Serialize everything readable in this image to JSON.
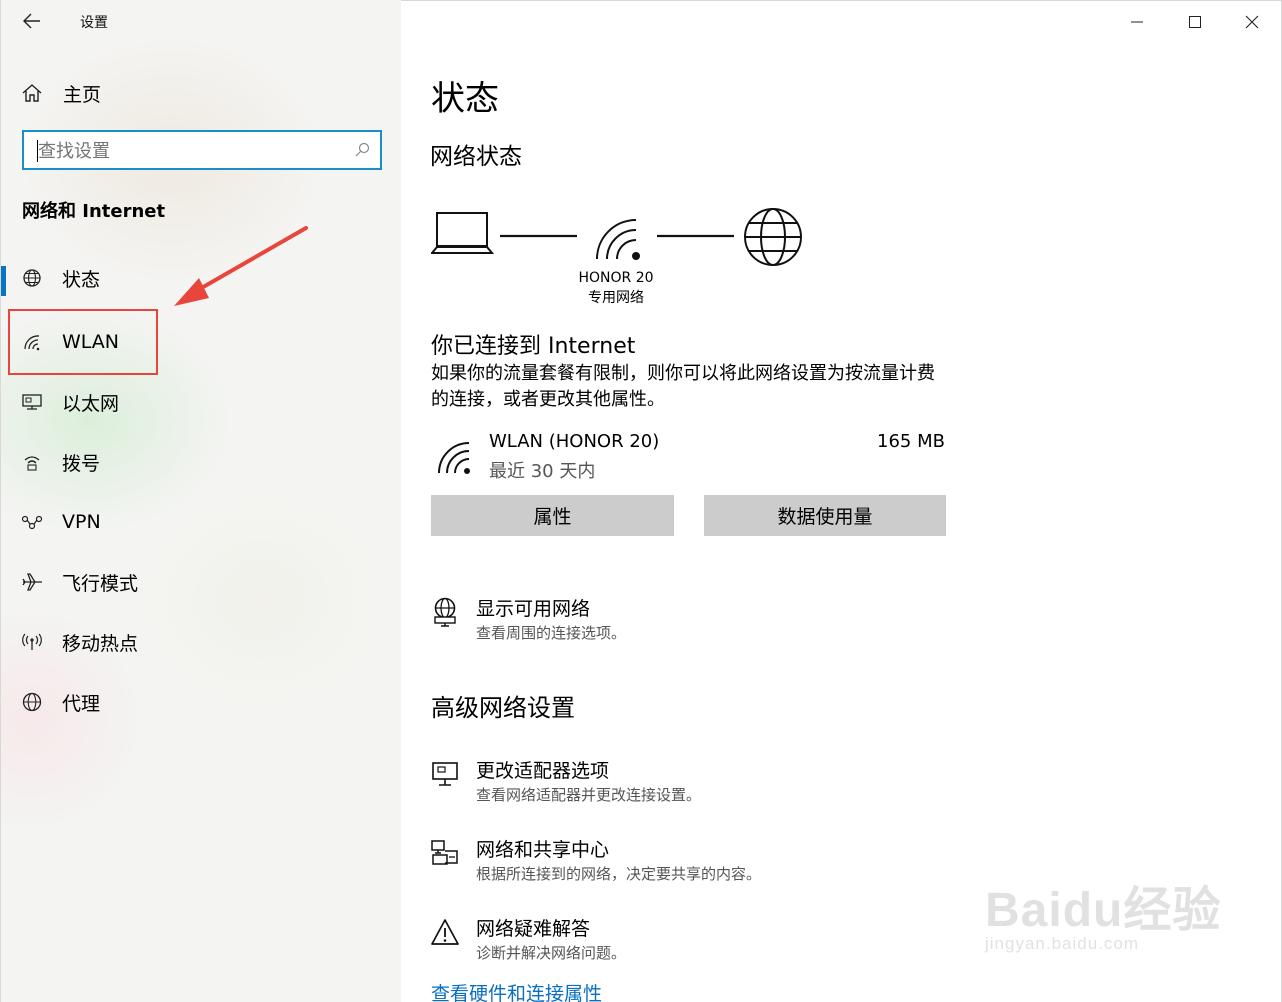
{
  "window": {
    "title": "设置",
    "controls": [
      "minimize",
      "maximize",
      "close"
    ]
  },
  "sidebar": {
    "home_label": "主页",
    "search_placeholder": "查找设置",
    "section_title": "网络和 Internet",
    "items": [
      {
        "label": "状态",
        "icon": "globe-status-icon",
        "active": true
      },
      {
        "label": "WLAN",
        "icon": "wifi-icon",
        "active": false
      },
      {
        "label": "以太网",
        "icon": "ethernet-icon",
        "active": false
      },
      {
        "label": "拨号",
        "icon": "dialup-icon",
        "active": false
      },
      {
        "label": "VPN",
        "icon": "vpn-icon",
        "active": false
      },
      {
        "label": "飞行模式",
        "icon": "airplane-icon",
        "active": false
      },
      {
        "label": "移动热点",
        "icon": "hotspot-icon",
        "active": false
      },
      {
        "label": "代理",
        "icon": "globe-icon",
        "active": false
      }
    ]
  },
  "main": {
    "page_title": "状态",
    "network_status_title": "网络状态",
    "network_name": "HONOR 20",
    "network_type": "专用网络",
    "connected_title": "你已连接到 Internet",
    "connected_desc": "如果你的流量套餐有限制，则你可以将此网络设置为按流量计费的连接，或者更改其他属性。",
    "connection": {
      "name": "WLAN (HONOR 20)",
      "period": "最近 30 天内",
      "usage": "165 MB"
    },
    "buttons": {
      "properties": "属性",
      "data_usage": "数据使用量"
    },
    "show_networks": {
      "title": "显示可用网络",
      "desc": "查看周围的连接选项。"
    },
    "advanced_title": "高级网络设置",
    "advanced_items": [
      {
        "title": "更改适配器选项",
        "desc": "查看网络适配器并更改连接设置。",
        "icon": "adapter-icon"
      },
      {
        "title": "网络和共享中心",
        "desc": "根据所连接到的网络，决定要共享的内容。",
        "icon": "sharing-center-icon"
      },
      {
        "title": "网络疑难解答",
        "desc": "诊断并解决网络问题。",
        "icon": "warning-icon"
      }
    ],
    "hardware_link": "查看硬件和连接属性"
  },
  "watermark": {
    "brand": "Baidu经验",
    "url": "jingyan.baidu.com"
  },
  "colors": {
    "accent": "#0a74c4",
    "highlight": "#e8453c",
    "search_border": "#1a8ec9",
    "button_bg": "#cccccc"
  }
}
